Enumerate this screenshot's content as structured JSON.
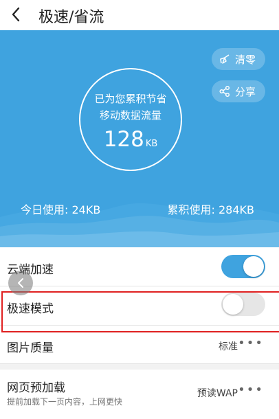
{
  "header": {
    "title": "极速/省流",
    "back_icon": "chevron-left-icon"
  },
  "hero": {
    "background_color": "#3fa3df",
    "clear_button": {
      "label": "清零",
      "icon": "broom-icon"
    },
    "share_button": {
      "label": "分享",
      "icon": "share-icon"
    },
    "saved_line1": "已为您累积节省",
    "saved_line2": "移动数据流量",
    "saved_value": "128",
    "saved_unit": "KB",
    "today_usage": "今日使用: 24KB",
    "total_usage": "累积使用: 284KB"
  },
  "settings": {
    "cloud_accel": {
      "label": "云端加速",
      "enabled": true
    },
    "speed_mode": {
      "label": "极速模式",
      "enabled": false
    },
    "image_quality": {
      "label": "图片质量",
      "value": "标准",
      "more_icon": "more-dots-icon"
    },
    "page_preload": {
      "label": "网页预加载",
      "sublabel": "提前加载下一页内容，上网更快",
      "value": "预读WAP",
      "more_icon": "more-dots-icon"
    }
  },
  "colors": {
    "accent": "#3fa3df",
    "highlight_border": "#e02020"
  }
}
